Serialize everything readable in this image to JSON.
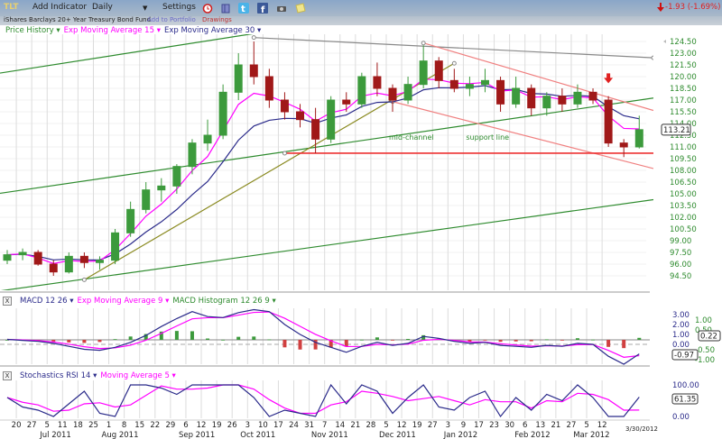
{
  "toolbar": {
    "symbol": "TLT",
    "add_indicator": "Add Indicator",
    "period": "Daily",
    "settings": "Settings",
    "icons": [
      "alarm-clock-icon",
      "books-icon",
      "twitter-icon",
      "facebook-icon",
      "camera-icon",
      "note-icon"
    ],
    "change": "-1.93 (-1.69%)",
    "change_color": "#e02020"
  },
  "subbar": {
    "fund_name": "iShares Barclays 20+ Year Treasury Bond Fund",
    "add_to_portfolio": "Add to Portfolio",
    "drawings": "Drawings"
  },
  "price_legend": [
    {
      "label": "Price History ▾",
      "color": "#2e8b2e"
    },
    {
      "label": "Exp Moving Average 15 ▾",
      "color": "#ff00ff"
    },
    {
      "label": "Exp Moving Average 30 ▾",
      "color": "#2a2a8a"
    }
  ],
  "macd_legend": [
    {
      "label": "MACD 12 26 ▾",
      "color": "#2a2a8a"
    },
    {
      "label": "Exp Moving Average 9 ▾",
      "color": "#ff00ff"
    },
    {
      "label": "MACD Histogram 12 26 9 ▾",
      "color": "#2e8b2e"
    }
  ],
  "stoch_legend": [
    {
      "label": "Stochastics RSI 14 ▾",
      "color": "#2a2a8a"
    },
    {
      "label": "Moving Average 5 ▾",
      "color": "#ff00ff"
    }
  ],
  "close_button": "X",
  "chart_data": [
    {
      "type": "candlestick",
      "panel": "price",
      "title": "",
      "granularity": "weekly (approximate)",
      "dates": [
        "2011-06-13",
        "2011-06-20",
        "2011-06-27",
        "2011-07-05",
        "2011-07-11",
        "2011-07-18",
        "2011-07-25",
        "2011-08-01",
        "2011-08-08",
        "2011-08-15",
        "2011-08-22",
        "2011-08-29",
        "2011-09-06",
        "2011-09-12",
        "2011-09-19",
        "2011-09-26",
        "2011-10-03",
        "2011-10-10",
        "2011-10-17",
        "2011-10-24",
        "2011-10-31",
        "2011-11-07",
        "2011-11-14",
        "2011-11-21",
        "2011-11-28",
        "2011-12-05",
        "2011-12-12",
        "2011-12-19",
        "2011-12-27",
        "2012-01-03",
        "2012-01-09",
        "2012-01-17",
        "2012-01-23",
        "2012-01-30",
        "2012-02-06",
        "2012-02-13",
        "2012-02-21",
        "2012-02-27",
        "2012-03-05",
        "2012-03-12",
        "2012-03-19",
        "2012-03-26"
      ],
      "ohlc": [
        [
          96.5,
          97.8,
          96,
          97.2
        ],
        [
          97.2,
          98,
          96.5,
          97.5
        ],
        [
          97.5,
          97.8,
          95.8,
          96
        ],
        [
          96,
          96.5,
          94.5,
          95
        ],
        [
          95,
          97.5,
          94.8,
          97
        ],
        [
          97,
          97.5,
          95.5,
          96.2
        ],
        [
          96.2,
          97,
          95.3,
          96.5
        ],
        [
          96.5,
          100.5,
          96,
          100
        ],
        [
          100,
          104,
          99.5,
          103
        ],
        [
          103,
          106.5,
          102.5,
          105.5
        ],
        [
          105.5,
          107,
          104,
          106
        ],
        [
          106,
          108.8,
          105,
          108.5
        ],
        [
          108.5,
          112,
          107.5,
          111.5
        ],
        [
          111.5,
          114.5,
          110.5,
          112.5
        ],
        [
          112.5,
          119,
          112,
          118
        ],
        [
          118,
          123,
          117,
          121.5
        ],
        [
          121.5,
          124.5,
          119,
          120
        ],
        [
          120,
          121,
          116,
          117
        ],
        [
          117,
          118,
          114.5,
          115.5
        ],
        [
          115.5,
          116.5,
          113.5,
          114.5
        ],
        [
          114.5,
          116,
          110.2,
          112
        ],
        [
          112,
          117.5,
          111.5,
          117
        ],
        [
          117,
          118,
          115.5,
          116.5
        ],
        [
          116.5,
          120.5,
          116,
          120
        ],
        [
          120,
          121.8,
          117.5,
          118.5
        ],
        [
          118.5,
          119,
          115.5,
          117
        ],
        [
          117,
          120,
          116.5,
          119
        ],
        [
          119,
          124,
          118.5,
          122
        ],
        [
          122,
          122.5,
          118.5,
          119.5
        ],
        [
          119.5,
          121,
          118,
          118.5
        ],
        [
          118.5,
          120,
          117.5,
          119
        ],
        [
          119,
          121,
          118,
          119.5
        ],
        [
          119.5,
          120,
          115.5,
          116.5
        ],
        [
          116.5,
          120,
          116,
          118.5
        ],
        [
          118.5,
          119,
          115,
          116
        ],
        [
          116,
          118,
          115,
          117.5
        ],
        [
          117.5,
          118.5,
          115.5,
          116.5
        ],
        [
          116.5,
          119,
          116,
          118
        ],
        [
          118,
          118.5,
          116.5,
          117
        ],
        [
          117,
          117.5,
          111,
          111.5
        ],
        [
          111.5,
          112,
          109.7,
          111
        ],
        [
          111,
          115,
          110.8,
          113.21
        ]
      ],
      "ema_periods": [
        15,
        30
      ],
      "last_price": "113.21",
      "yticks": [
        "124.50",
        "123.00",
        "121.50",
        "120.00",
        "118.50",
        "117.00",
        "115.50",
        "114.00",
        "112.50",
        "111.00",
        "109.50",
        "108.00",
        "106.50",
        "105.00",
        "103.50",
        "102.00",
        "100.50",
        "99.00",
        "97.50",
        "96.00",
        "94.50"
      ],
      "ylim": [
        94.5,
        124.5
      ],
      "grid": true,
      "up_color": "#3c9a3c",
      "down_color": "#a01818",
      "annotations": {
        "lines": [
          {
            "name": "upper-green-channel",
            "color": "#2e8b2e",
            "p1": [
              "2011-06-13",
              120.6
            ],
            "p2": [
              "2011-09-26",
              125.2
            ],
            "extend": "both"
          },
          {
            "name": "mid-channel",
            "color": "#2e8b2e",
            "p1": [
              "2011-06-13",
              105.2
            ],
            "p2": [
              "2012-03-26",
              117.0
            ],
            "extend": "both"
          },
          {
            "name": "lower-green-channel",
            "color": "#2e8b2e",
            "p1": [
              "2011-06-13",
              92.7
            ],
            "p2": [
              "2012-03-26",
              104.0
            ],
            "extend": "both"
          },
          {
            "name": "support-line",
            "color": "#8a8a20",
            "p1": [
              "2011-07-18",
              94.0
            ],
            "p2": [
              "2012-01-03",
              121.7
            ],
            "extend": "none"
          },
          {
            "name": "grey-resistance",
            "color": "#888888",
            "p1": [
              "2011-10-03",
              125.0
            ],
            "p2": [
              "2012-03-26",
              122.5
            ],
            "extend": "right"
          },
          {
            "name": "red-channel-upper",
            "color": "#f08080",
            "p1": [
              "2011-12-19",
              124.3
            ],
            "p2": [
              "2012-03-26",
              116.2
            ],
            "extend": "right"
          },
          {
            "name": "red-channel-lower",
            "color": "#f08080",
            "p1": [
              "2011-12-05",
              116.8
            ],
            "p2": [
              "2012-03-26",
              108.7
            ],
            "extend": "right"
          },
          {
            "name": "horizontal-support",
            "color": "#ee3030",
            "p1": [
              "2011-10-17",
              110.2
            ],
            "p2": [
              "2012-03-26",
              110.2
            ],
            "extend": "right"
          }
        ],
        "labels": [
          {
            "text": "mid-channel",
            "date": "2011-12-05",
            "price": 111.9,
            "color": "#2e8b2e"
          },
          {
            "text": "support line",
            "date": "2012-01-09",
            "price": 111.9,
            "color": "#2e8b2e"
          }
        ],
        "arrow": {
          "date": "2012-03-12",
          "price": 119.5,
          "color": "#e02020"
        }
      }
    },
    {
      "type": "line+bar",
      "panel": "macd",
      "macd": [
        0.5,
        0.4,
        0.3,
        0.1,
        -0.2,
        -0.5,
        -0.6,
        -0.3,
        0.2,
        0.9,
        1.8,
        2.6,
        3.3,
        2.8,
        2.7,
        3.2,
        3.5,
        3.3,
        2.0,
        1.0,
        0.2,
        -0.3,
        -0.8,
        -0.2,
        0.2,
        -0.1,
        0.1,
        0.8,
        0.6,
        0.3,
        0.1,
        0.2,
        -0.1,
        -0.2,
        -0.3,
        -0.1,
        -0.2,
        0.1,
        0.0,
        -1.2,
        -2.0,
        -0.97
      ],
      "signal_period": 9,
      "macd_value": "-0.97",
      "histogram_value": "0.22",
      "yticks_macd": [
        "3.00",
        "2.00",
        "1.00",
        "0.00"
      ],
      "yticks_hist": [
        "1.00",
        "0.50",
        "-0.50",
        "-1.00"
      ],
      "macd_color": "#2a2a8a",
      "signal_color": "#ff00ff",
      "hist_up_color": "#3c9a3c",
      "hist_down_color": "#d04040"
    },
    {
      "type": "line",
      "panel": "stochastics",
      "stoch_rsi": [
        60,
        30,
        20,
        0,
        40,
        80,
        10,
        0,
        100,
        100,
        90,
        70,
        100,
        100,
        100,
        100,
        60,
        0,
        20,
        10,
        0,
        100,
        40,
        100,
        80,
        10,
        60,
        100,
        30,
        20,
        60,
        80,
        0,
        60,
        20,
        70,
        50,
        100,
        60,
        0,
        0,
        61.35
      ],
      "ma_period": 5,
      "value": "61.35",
      "yticks": [
        "100.00",
        "0.00"
      ],
      "ylim": [
        0,
        100
      ]
    }
  ],
  "x_axis": {
    "day_labels": [
      "20",
      "27",
      "5",
      "11",
      "18",
      "25",
      "1",
      "8",
      "15",
      "22",
      "29",
      "6",
      "12",
      "19",
      "26",
      "3",
      "10",
      "17",
      "24",
      "31",
      "7",
      "14",
      "21",
      "28",
      "5",
      "12",
      "19",
      "27",
      "3",
      "9",
      "17",
      "23",
      "30",
      "6",
      "13",
      "21",
      "27",
      "5",
      "12"
    ],
    "month_labels": [
      {
        "text": "2011",
        "week": -0.9
      },
      {
        "text": "Jul 2011",
        "week": 3
      },
      {
        "text": "Aug 2011",
        "week": 7
      },
      {
        "text": "Sep 2011",
        "week": 12
      },
      {
        "text": "Oct 2011",
        "week": 16
      },
      {
        "text": "Nov 2011",
        "week": 20.6
      },
      {
        "text": "Dec 2011",
        "week": 25
      },
      {
        "text": "Jan 2012",
        "week": 29.2
      },
      {
        "text": "Feb 2012",
        "week": 33.8
      },
      {
        "text": "Mar 2012",
        "week": 37.6
      }
    ],
    "end_date": "3/30/2012"
  }
}
